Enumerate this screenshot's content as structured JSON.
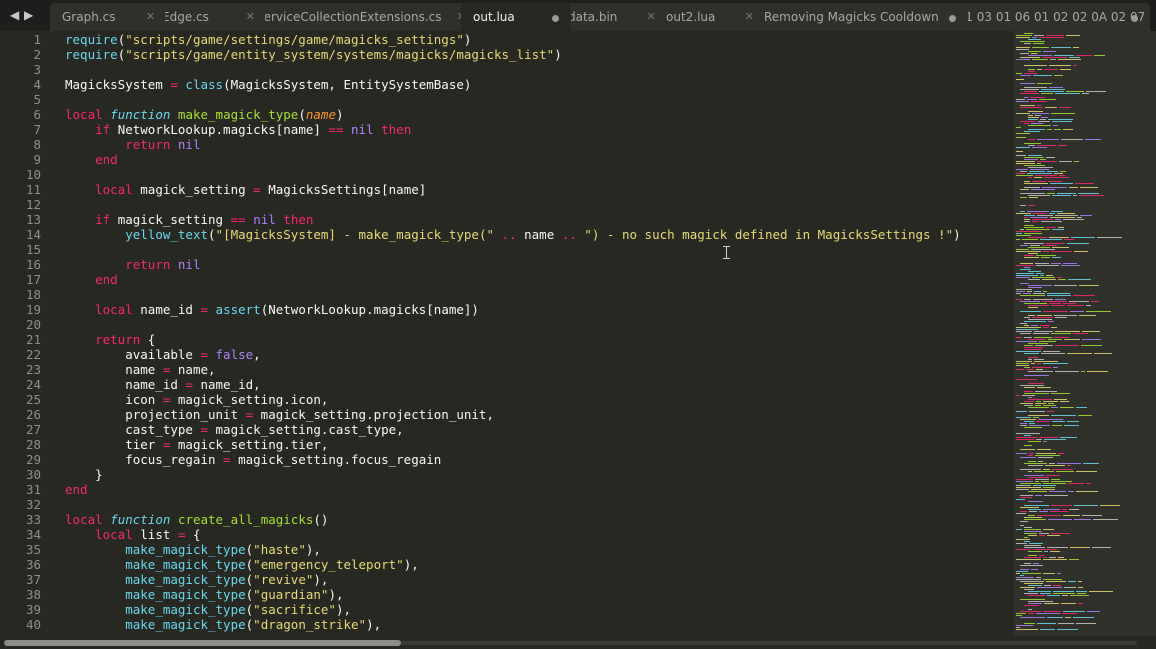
{
  "tabbar": {
    "nav_left_icon": "chevron-left-icon",
    "nav_right_icon": "chevron-right-icon",
    "tabs": [
      {
        "label": "Graph.cs",
        "state": "close",
        "active": false
      },
      {
        "label": "Edge.cs",
        "state": "close",
        "active": false
      },
      {
        "label": "ServiceCollectionExtensions.cs",
        "state": "close",
        "active": false
      },
      {
        "label": "out.lua",
        "state": "modified",
        "active": true
      },
      {
        "label": "data.bin",
        "state": "close",
        "active": false
      },
      {
        "label": "out2.lua",
        "state": "close",
        "active": false
      },
      {
        "label": "Removing Magicks Cooldown",
        "state": "modified",
        "active": false
      },
      {
        "label": "'1 03 01 06 01 02 02 0A 02 07",
        "state": "modified",
        "active": false
      }
    ],
    "close_glyph": "✕",
    "dropdown_icon": "tab-list-dropdown-icon"
  },
  "editor": {
    "lines": [
      [
        {
          "t": "require",
          "c": "b"
        },
        {
          "t": "(",
          "c": "t"
        },
        {
          "t": "\"scripts/game/settings/game/magicks_settings\"",
          "c": "s"
        },
        {
          "t": ")",
          "c": "t"
        }
      ],
      [
        {
          "t": "require",
          "c": "b"
        },
        {
          "t": "(",
          "c": "t"
        },
        {
          "t": "\"scripts/game/entity_system/systems/magicks/magicks_list\"",
          "c": "s"
        },
        {
          "t": ")",
          "c": "t"
        }
      ],
      [],
      [
        {
          "t": "MagicksSystem",
          "c": "t"
        },
        {
          "t": " = ",
          "c": "k"
        },
        {
          "t": "class",
          "c": "b"
        },
        {
          "t": "(MagicksSystem, EntitySystemBase)",
          "c": "t"
        }
      ],
      [],
      [
        {
          "t": "local",
          "c": "k"
        },
        {
          "t": " ",
          "c": "t"
        },
        {
          "t": "function",
          "c": "sk"
        },
        {
          "t": " ",
          "c": "t"
        },
        {
          "t": "make_magick_type",
          "c": "f"
        },
        {
          "t": "(",
          "c": "t"
        },
        {
          "t": "name",
          "c": "p"
        },
        {
          "t": ")",
          "c": "t"
        }
      ],
      [
        {
          "t": "    ",
          "c": "t"
        },
        {
          "t": "if",
          "c": "k"
        },
        {
          "t": " NetworkLookup.magicks[name] ",
          "c": "t"
        },
        {
          "t": "==",
          "c": "k"
        },
        {
          "t": " ",
          "c": "t"
        },
        {
          "t": "nil",
          "c": "c"
        },
        {
          "t": " ",
          "c": "t"
        },
        {
          "t": "then",
          "c": "k"
        }
      ],
      [
        {
          "t": "        ",
          "c": "t"
        },
        {
          "t": "return",
          "c": "k"
        },
        {
          "t": " ",
          "c": "t"
        },
        {
          "t": "nil",
          "c": "c"
        }
      ],
      [
        {
          "t": "    ",
          "c": "t"
        },
        {
          "t": "end",
          "c": "k"
        }
      ],
      [],
      [
        {
          "t": "    ",
          "c": "t"
        },
        {
          "t": "local",
          "c": "k"
        },
        {
          "t": " magick_setting ",
          "c": "t"
        },
        {
          "t": "=",
          "c": "k"
        },
        {
          "t": " MagicksSettings[name]",
          "c": "t"
        }
      ],
      [],
      [
        {
          "t": "    ",
          "c": "t"
        },
        {
          "t": "if",
          "c": "k"
        },
        {
          "t": " magick_setting ",
          "c": "t"
        },
        {
          "t": "==",
          "c": "k"
        },
        {
          "t": " ",
          "c": "t"
        },
        {
          "t": "nil",
          "c": "c"
        },
        {
          "t": " ",
          "c": "t"
        },
        {
          "t": "then",
          "c": "k"
        }
      ],
      [
        {
          "t": "        ",
          "c": "t"
        },
        {
          "t": "yellow_text",
          "c": "b"
        },
        {
          "t": "(",
          "c": "t"
        },
        {
          "t": "\"[MagicksSystem] - make_magick_type(\"",
          "c": "s"
        },
        {
          "t": " ",
          "c": "t"
        },
        {
          "t": "..",
          "c": "k"
        },
        {
          "t": " name ",
          "c": "t"
        },
        {
          "t": "..",
          "c": "k"
        },
        {
          "t": " ",
          "c": "t"
        },
        {
          "t": "\") - no such magick defined in MagicksSettings !\"",
          "c": "s"
        },
        {
          "t": ")",
          "c": "t"
        }
      ],
      [],
      [
        {
          "t": "        ",
          "c": "t"
        },
        {
          "t": "return",
          "c": "k"
        },
        {
          "t": " ",
          "c": "t"
        },
        {
          "t": "nil",
          "c": "c"
        }
      ],
      [
        {
          "t": "    ",
          "c": "t"
        },
        {
          "t": "end",
          "c": "k"
        }
      ],
      [],
      [
        {
          "t": "    ",
          "c": "t"
        },
        {
          "t": "local",
          "c": "k"
        },
        {
          "t": " name_id ",
          "c": "t"
        },
        {
          "t": "=",
          "c": "k"
        },
        {
          "t": " ",
          "c": "t"
        },
        {
          "t": "assert",
          "c": "b"
        },
        {
          "t": "(NetworkLookup.magicks[name])",
          "c": "t"
        }
      ],
      [],
      [
        {
          "t": "    ",
          "c": "t"
        },
        {
          "t": "return",
          "c": "k"
        },
        {
          "t": " {",
          "c": "t"
        }
      ],
      [
        {
          "t": "        available ",
          "c": "t"
        },
        {
          "t": "=",
          "c": "k"
        },
        {
          "t": " ",
          "c": "t"
        },
        {
          "t": "false",
          "c": "c"
        },
        {
          "t": ",",
          "c": "t"
        }
      ],
      [
        {
          "t": "        name ",
          "c": "t"
        },
        {
          "t": "=",
          "c": "k"
        },
        {
          "t": " name,",
          "c": "t"
        }
      ],
      [
        {
          "t": "        name_id ",
          "c": "t"
        },
        {
          "t": "=",
          "c": "k"
        },
        {
          "t": " name_id,",
          "c": "t"
        }
      ],
      [
        {
          "t": "        icon ",
          "c": "t"
        },
        {
          "t": "=",
          "c": "k"
        },
        {
          "t": " magick_setting.icon,",
          "c": "t"
        }
      ],
      [
        {
          "t": "        projection_unit ",
          "c": "t"
        },
        {
          "t": "=",
          "c": "k"
        },
        {
          "t": " magick_setting.projection_unit,",
          "c": "t"
        }
      ],
      [
        {
          "t": "        cast_type ",
          "c": "t"
        },
        {
          "t": "=",
          "c": "k"
        },
        {
          "t": " magick_setting.cast_type,",
          "c": "t"
        }
      ],
      [
        {
          "t": "        tier ",
          "c": "t"
        },
        {
          "t": "=",
          "c": "k"
        },
        {
          "t": " magick_setting.tier,",
          "c": "t"
        }
      ],
      [
        {
          "t": "        focus_regain ",
          "c": "t"
        },
        {
          "t": "=",
          "c": "k"
        },
        {
          "t": " magick_setting.focus_regain",
          "c": "t"
        }
      ],
      [
        {
          "t": "    }",
          "c": "t"
        }
      ],
      [
        {
          "t": "end",
          "c": "k"
        }
      ],
      [],
      [
        {
          "t": "local",
          "c": "k"
        },
        {
          "t": " ",
          "c": "t"
        },
        {
          "t": "function",
          "c": "sk"
        },
        {
          "t": " ",
          "c": "t"
        },
        {
          "t": "create_all_magicks",
          "c": "f"
        },
        {
          "t": "()",
          "c": "t"
        }
      ],
      [
        {
          "t": "    ",
          "c": "t"
        },
        {
          "t": "local",
          "c": "k"
        },
        {
          "t": " list ",
          "c": "t"
        },
        {
          "t": "=",
          "c": "k"
        },
        {
          "t": " {",
          "c": "t"
        }
      ],
      [
        {
          "t": "        ",
          "c": "t"
        },
        {
          "t": "make_magick_type",
          "c": "b"
        },
        {
          "t": "(",
          "c": "t"
        },
        {
          "t": "\"haste\"",
          "c": "s"
        },
        {
          "t": "),",
          "c": "t"
        }
      ],
      [
        {
          "t": "        ",
          "c": "t"
        },
        {
          "t": "make_magick_type",
          "c": "b"
        },
        {
          "t": "(",
          "c": "t"
        },
        {
          "t": "\"emergency_teleport\"",
          "c": "s"
        },
        {
          "t": "),",
          "c": "t"
        }
      ],
      [
        {
          "t": "        ",
          "c": "t"
        },
        {
          "t": "make_magick_type",
          "c": "b"
        },
        {
          "t": "(",
          "c": "t"
        },
        {
          "t": "\"revive\"",
          "c": "s"
        },
        {
          "t": "),",
          "c": "t"
        }
      ],
      [
        {
          "t": "        ",
          "c": "t"
        },
        {
          "t": "make_magick_type",
          "c": "b"
        },
        {
          "t": "(",
          "c": "t"
        },
        {
          "t": "\"guardian\"",
          "c": "s"
        },
        {
          "t": "),",
          "c": "t"
        }
      ],
      [
        {
          "t": "        ",
          "c": "t"
        },
        {
          "t": "make_magick_type",
          "c": "b"
        },
        {
          "t": "(",
          "c": "t"
        },
        {
          "t": "\"sacrifice\"",
          "c": "s"
        },
        {
          "t": "),",
          "c": "t"
        }
      ],
      [
        {
          "t": "        ",
          "c": "t"
        },
        {
          "t": "make_magick_type",
          "c": "b"
        },
        {
          "t": "(",
          "c": "t"
        },
        {
          "t": "\"dragon_strike\"",
          "c": "s"
        },
        {
          "t": "),",
          "c": "t"
        }
      ]
    ],
    "first_line_number": 1
  },
  "theme": {
    "keyword": "#f92672",
    "string": "#e6db74",
    "function_name": "#a6e22e",
    "builtin": "#66d9ef",
    "constant": "#ae81ff",
    "parameter": "#fd971f",
    "text": "#f8f8f2",
    "background": "#272822",
    "tabbar_background": "#1e1f1c",
    "line_number": "#8f908a"
  },
  "horizontal_scrollbar": {
    "thumb_fraction": 0.35
  }
}
